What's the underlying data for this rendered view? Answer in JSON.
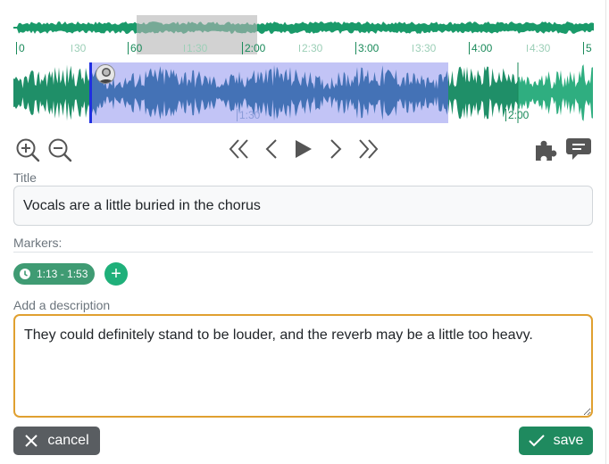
{
  "overview": {
    "ticks": [
      {
        "label": "0",
        "major": true
      },
      {
        "label": "30",
        "major": false
      },
      {
        "label": "60",
        "major": true
      },
      {
        "label": "1:30",
        "major": false
      },
      {
        "label": "2:00",
        "major": true
      },
      {
        "label": "2:30",
        "major": false
      },
      {
        "label": "3:00",
        "major": true
      },
      {
        "label": "3:30",
        "major": false
      },
      {
        "label": "4:00",
        "major": true
      },
      {
        "label": "4:30",
        "major": false
      },
      {
        "label": "5",
        "major": true
      }
    ],
    "colors": {
      "wave": "#1a9a6a",
      "viewport": "#bdbdbd"
    }
  },
  "zoom": {
    "ticks": [
      "1:30",
      "2:00"
    ],
    "colors": {
      "wave": "#1f8f68",
      "wave_light": "#2fae80",
      "region": "#7f85ea",
      "region_edge": "#1f2fe0",
      "wave_in_region": "#1a6a8a"
    }
  },
  "toolbar": {
    "zoom_in": "zoom-in-icon",
    "zoom_out": "zoom-out-icon",
    "skip_back": "double-chevron-left-icon",
    "step_back": "chevron-left-icon",
    "play": "play-icon",
    "step_forward": "chevron-right-icon",
    "skip_forward": "double-chevron-right-icon",
    "plugins": "puzzle-icon",
    "comments": "comment-icon"
  },
  "form": {
    "title_label": "Title",
    "title_value": "Vocals are a little buried in the chorus",
    "markers_label": "Markers:",
    "marker": "1:13 - 1:53",
    "description_label": "Add a description",
    "description_value": "They could definitely stand to be louder, and the reverb may be a little too heavy."
  },
  "buttons": {
    "cancel": "cancel",
    "save": "save"
  },
  "colors": {
    "accent": "#1f8a5f",
    "focus": "#e0a030",
    "cancel": "#595d61"
  }
}
